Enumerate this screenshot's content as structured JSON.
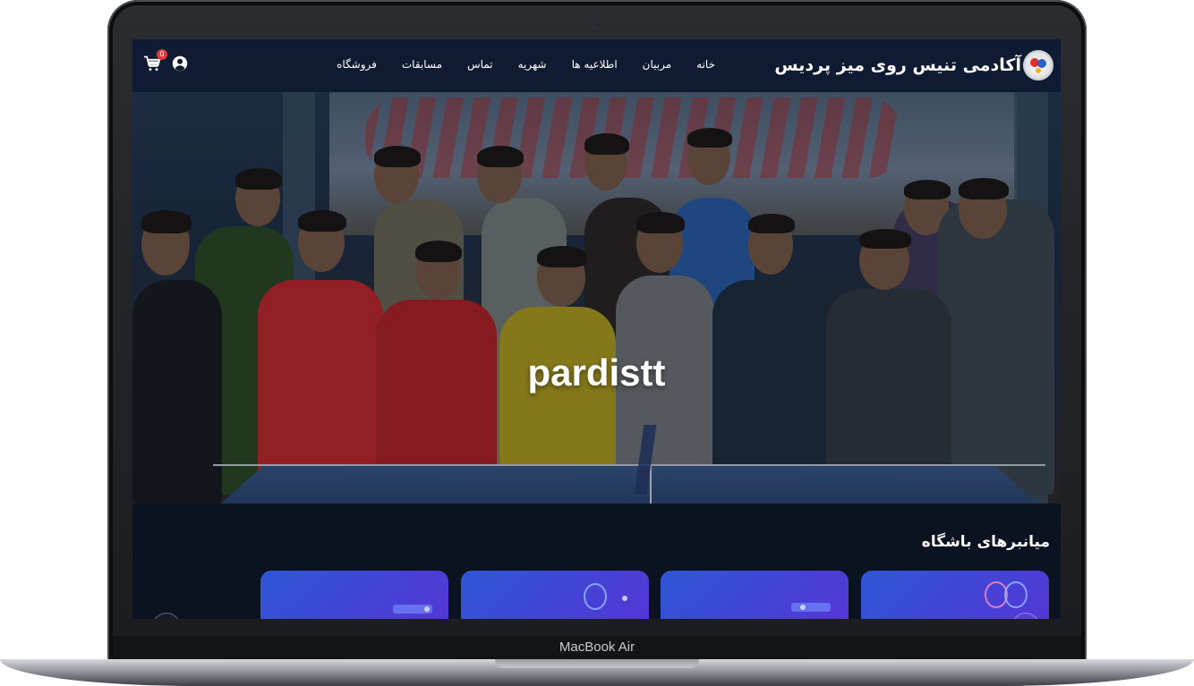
{
  "device": {
    "model_label": "MacBook Air"
  },
  "site": {
    "brand_name": "آکادمی تنیس روی میز پردیس",
    "nav": {
      "items": [
        "خانه",
        "مربیان",
        "اطلاعیه ها",
        "شهریه",
        "تماس",
        "مسابقات",
        "فروشگاه"
      ]
    },
    "cart_count": "0"
  },
  "hero": {
    "title": "pardistt"
  },
  "section": {
    "title": "میانبرهای باشگاه"
  },
  "icons": [
    "brand-logo-icon",
    "cart-icon",
    "user-icon",
    "chevron-left-icon",
    "chevron-right-icon"
  ],
  "colors": {
    "navbar_bg": "#0f1a33",
    "page_bg": "#0b1220",
    "card_gradient_start": "#2d57d6",
    "card_gradient_end": "#5535d6",
    "badge": "#e53935"
  }
}
